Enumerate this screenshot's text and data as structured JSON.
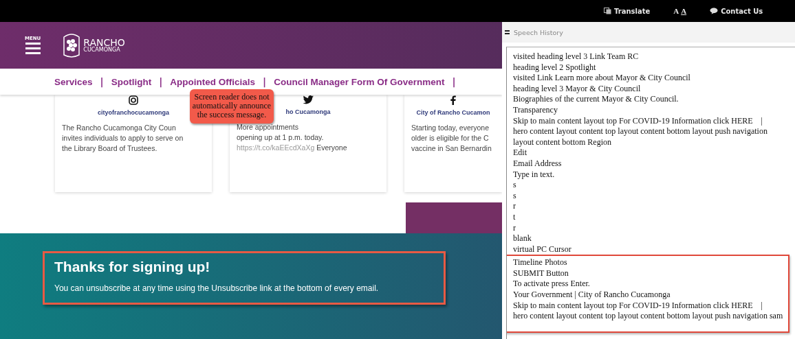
{
  "top_bar": {
    "translate": "Translate",
    "text_size": {
      "small": "A",
      "large": "A"
    },
    "contact": "Contact Us"
  },
  "header": {
    "menu_label": "MENU",
    "logo": {
      "line1": "RANCHO",
      "line2": "CUCAMONGA"
    }
  },
  "nav": {
    "separator": "|",
    "items": [
      "Services",
      "Spotlight",
      "Appointed Officials",
      "Council Manager Form Of Government"
    ]
  },
  "cards": [
    {
      "kind": "instagram",
      "handle": "cityofranchocucamonga",
      "lines": [
        "The Rancho Cucamonga City Coun",
        "invites individuals to apply to serve on",
        "the Library Board of Trustees."
      ]
    },
    {
      "kind": "twitter",
      "handle": "ho Cucamonga",
      "lines": [
        "More appointments",
        "opening up at 1 p.m. today."
      ],
      "link": "https://t.co/kaEEcdXaXg",
      "after": "Everyone"
    },
    {
      "kind": "facebook",
      "handle": "City of Rancho Cucamon",
      "lines": [
        "Starting today, everyone",
        "older is eligible for the C",
        "vaccine in San Bernardin"
      ]
    }
  ],
  "callout": {
    "text": "Screen reader does not automatically announce the success message."
  },
  "signup": {
    "title": "Thanks for signing up!",
    "message": "You can unsubscribe at any time using the Unsubscribe link at the bottom of every email."
  },
  "speech_history": {
    "title": "Speech History",
    "lines": [
      "visited heading level 3 Link Team RC",
      "heading level 2 Spotlight",
      "visited Link Learn more about Mayor & City Council",
      "heading level 3 Mayor & City Council",
      "Biographies of the current Mayor & City Council.",
      "Transparency",
      "Skip to main content layout top For COVID-19 Information click HERE    |",
      "hero content layout content top layout content bottom layout push navigation",
      "layout content bottom Region",
      "Edit",
      "Email Address",
      "Type in text.",
      "s",
      "s",
      "r",
      "t",
      "r",
      "blank",
      "virtual PC Cursor"
    ],
    "highlighted_lines": [
      "Timeline Photos",
      "SUBMIT Button",
      "To activate press Enter.",
      "Your Government | City of Rancho Cucamonga",
      "Skip to main content layout top For COVID-19 Information click HERE    |",
      "hero content layout content top layout content bottom layout push navigation sam"
    ]
  }
}
